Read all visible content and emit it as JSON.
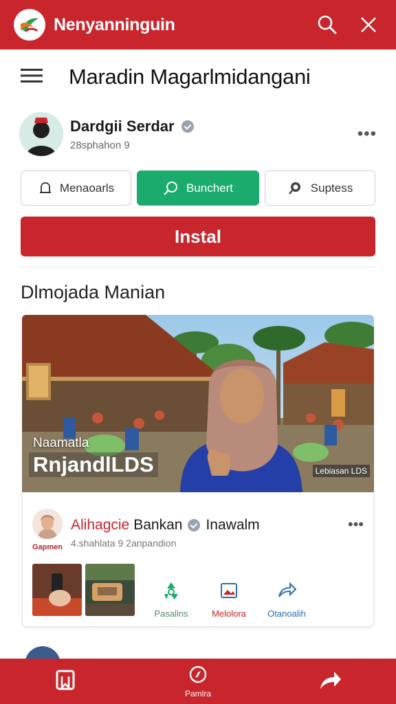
{
  "appbar": {
    "title": "Nenyanninguin",
    "logo_icon": "leaf-logo-icon",
    "search_icon": "search-icon",
    "close_icon": "close-icon",
    "color": "#c8252c"
  },
  "header": {
    "menu_icon": "hamburger-menu-icon",
    "title": "Maradin Magarlmidangani"
  },
  "profile": {
    "name": "Dardgii Serdar",
    "subtitle": "28sphahon 9",
    "verified": true,
    "more_icon": "more-horizontal-icon"
  },
  "actions": [
    {
      "label": "Menaoarls",
      "icon": "bell-icon"
    },
    {
      "label": "Bunchert",
      "icon": "search-icon",
      "accent": "#1aab6d"
    },
    {
      "label": "Suptess",
      "icon": "search-icon"
    }
  ],
  "install": {
    "label": "Instal"
  },
  "section": {
    "title": "Dlmojada Manian"
  },
  "hero": {
    "caption_line1": "Naamatla",
    "caption_line2": "RnjandlLDS",
    "tag": "Lebiasan LDS"
  },
  "post": {
    "author_red": "Alihagcie",
    "author_rest": "Bankan",
    "author_tail": "Inawalm",
    "avatar_label": "Gapmen",
    "subtitle": "4.shahlata 9  2anpandion",
    "actions": [
      {
        "label": "Pasallns",
        "icon": "recycle-icon",
        "color": "#1aab6d"
      },
      {
        "label": "Melolora",
        "icon": "photo-icon",
        "color": "#c8252c"
      },
      {
        "label": "Otanoalih",
        "icon": "share-icon",
        "color": "#2a6fb0"
      }
    ]
  },
  "bottomnav": {
    "items": [
      {
        "label": "",
        "icon": "bookmark-icon"
      },
      {
        "label": "Pamlra",
        "icon": "compass-icon"
      },
      {
        "label": "",
        "icon": "share-arrow-icon"
      }
    ]
  }
}
